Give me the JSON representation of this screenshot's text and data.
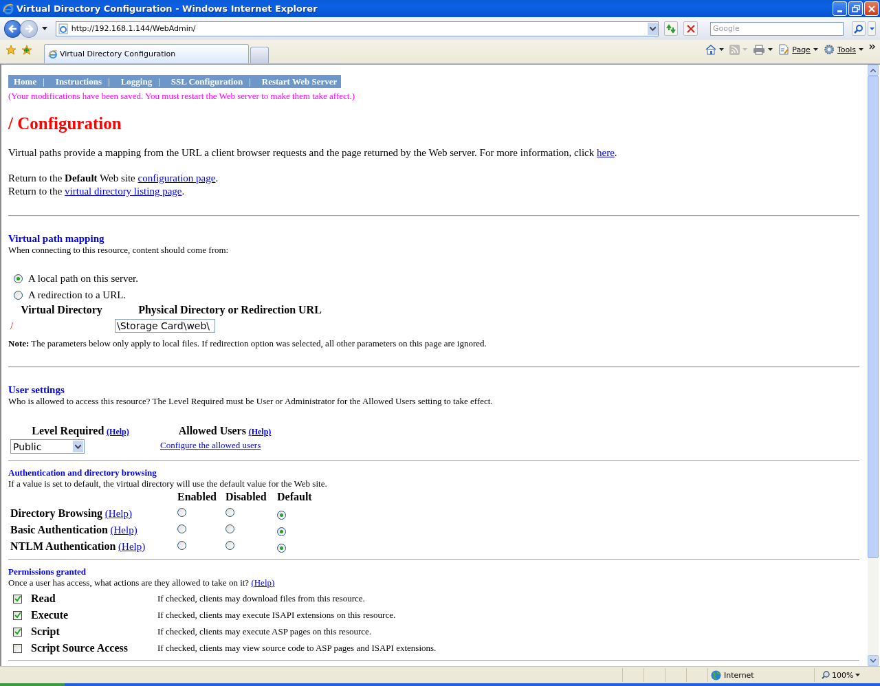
{
  "window": {
    "title": "Virtual Directory Configuration - Windows Internet Explorer"
  },
  "address_bar": {
    "url": "http://192.168.1.144/WebAdmin/"
  },
  "search": {
    "placeholder": "Google"
  },
  "tabs": [
    {
      "label": "Virtual Directory Configuration",
      "selected": true
    }
  ],
  "command_bar": [
    {
      "kind": "home",
      "disabled": false
    },
    {
      "kind": "feeds",
      "disabled": true
    },
    {
      "kind": "print",
      "disabled": false
    },
    {
      "kind": "page",
      "label": "Page",
      "disabled": false
    },
    {
      "kind": "tools",
      "label": "Tools",
      "disabled": false
    }
  ],
  "page": {
    "nav": {
      "items": [
        "Home",
        "Instructions",
        "Logging",
        "SSL Configuration",
        "Restart Web Server"
      ],
      "separator": "|"
    },
    "notice": "(Your modifications have been saved. You must restart the Web server to make them take affect.)",
    "heading": "/ Configuration",
    "intro": {
      "text": "Virtual paths provide a mapping from the URL a client browser requests and the page returned by the Web server. For more information, click ",
      "link": "here",
      "after": "."
    },
    "return_links": [
      {
        "text": "Return to the **Default** Web site ",
        "link": "configuration page",
        "after": "."
      },
      {
        "text": "Return to the ",
        "link": "virtual directory listing page",
        "after": "."
      }
    ],
    "virtual_path_mapping": {
      "title": "Virtual path mapping",
      "description": "When connecting to this resource, content should come from:",
      "options": [
        {
          "label": "A local path on this server.",
          "selected": true
        },
        {
          "label": "A redirection to a URL.",
          "selected": false
        }
      ],
      "columns": [
        "Virtual Directory",
        "Physical Directory or Redirection URL"
      ],
      "virtual_directory": "/",
      "physical_directory": "\\Storage Card\\web\\",
      "note": "**Note:** The parameters below only apply to local files. If redirection option was selected, all other parameters on this page are ignored."
    },
    "user_settings": {
      "title": "User settings",
      "description": "Who is allowed to access this resource? The Level Required must be User or Administrator for the Allowed Users setting to take effect.",
      "level_required": {
        "label": "Level Required",
        "help": "(Help)",
        "value": "Public"
      },
      "allowed_users": {
        "label": "Allowed Users",
        "help": "(Help)",
        "link": "Configure the allowed users"
      }
    },
    "authentication": {
      "title": "Authentication and directory browsing",
      "description": "If a value is set to default, the virtual directory will use the default value for the Web site.",
      "columns": [
        "Enabled",
        "Disabled",
        "Default"
      ],
      "rows": [
        {
          "label": "Directory Browsing",
          "help": "(Help)",
          "options": [
            {
              "selected": false
            },
            {
              "selected": false
            },
            {
              "selected": true
            }
          ]
        },
        {
          "label": "Basic Authentication",
          "help": "(Help)",
          "options": [
            {
              "selected": false
            },
            {
              "selected": false
            },
            {
              "selected": true
            }
          ]
        },
        {
          "label": "NTLM Authentication",
          "help": "(Help)",
          "options": [
            {
              "selected": false
            },
            {
              "selected": false
            },
            {
              "selected": true
            }
          ]
        }
      ]
    },
    "permissions": {
      "title": "Permissions granted",
      "description": "Once a user has access, what actions are they allowed to take on it? ",
      "help": "(Help)",
      "items": [
        {
          "label": "Read",
          "checked": true,
          "description": "If checked, clients may download files from this resource."
        },
        {
          "label": "Execute",
          "checked": true,
          "description": "If checked, clients may execute ISAPI extensions on this resource."
        },
        {
          "label": "Script",
          "checked": true,
          "description": "If checked, clients may execute ASP pages on this resource."
        },
        {
          "label": "Script Source Access",
          "checked": false,
          "description": "If checked, clients may view source code to ASP pages and ISAPI extensions."
        }
      ]
    }
  },
  "status_bar": {
    "zone": "Internet",
    "zoom": "100%"
  }
}
